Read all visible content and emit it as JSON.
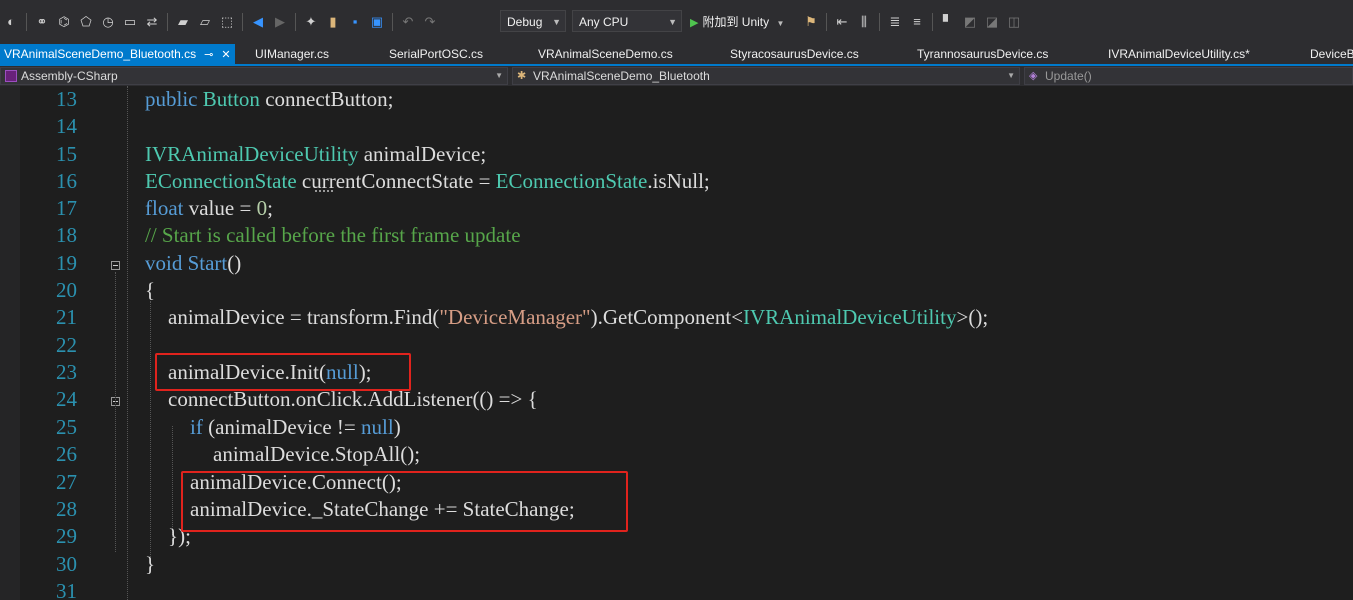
{
  "toolbar": {
    "config_dropdown": "Debug",
    "platform_dropdown": "Any CPU",
    "run_label": "附加到 Unity",
    "icons": [
      "nav-icon",
      "solution-icon",
      "diagram-icon",
      "tag-icon",
      "history-icon",
      "window-icon",
      "sync-icon",
      "folder-icon",
      "open-folder-icon",
      "select-icon",
      "back-icon",
      "forward-icon",
      "new-project-icon",
      "open-icon",
      "save-icon",
      "save-all-icon",
      "undo-icon",
      "redo-icon",
      "find-icon",
      "comment-icon",
      "uncomment-icon",
      "bookmark-icon"
    ]
  },
  "tabs": [
    {
      "label": "VRAnimalSceneDemo_Bluetooth.cs",
      "active": true
    },
    {
      "label": "UIManager.cs"
    },
    {
      "label": "SerialPortOSC.cs"
    },
    {
      "label": "VRAnimalSceneDemo.cs"
    },
    {
      "label": "StyracosaurusDevice.cs"
    },
    {
      "label": "TyrannosaurusDevice.cs"
    },
    {
      "label": "IVRAnimalDeviceUtility.cs*"
    },
    {
      "label": "DeviceBa"
    }
  ],
  "navbar": {
    "project": "Assembly-CSharp",
    "class": "VRAnimalSceneDemo_Bluetooth",
    "member": "Update()"
  },
  "editor": {
    "line_numbers": [
      "13",
      "14",
      "15",
      "16",
      "17",
      "18",
      "19",
      "20",
      "21",
      "22",
      "23",
      "24",
      "25",
      "26",
      "27",
      "28",
      "29",
      "30",
      "31"
    ],
    "lines": {
      "l13": {
        "kw": "public",
        "ty": "Button",
        "rest": "connectButton;"
      },
      "l15": {
        "ty": "IVRAnimalDeviceUtility",
        "rest": "animalDevice;"
      },
      "l16": {
        "ty1": "EConnectionState",
        "v": "currentConnectState",
        "eq": "=",
        "ty2": "EConnectionState",
        "rest": ".isNull;"
      },
      "l17": {
        "kw": "float",
        "rest": "value =",
        "num": "0",
        "end": ";"
      },
      "l18": {
        "comment": "// Start is called before the first frame update"
      },
      "l19": {
        "kw": "void",
        "fn": "Start",
        "rest": "()"
      },
      "l20": {
        "text": "{"
      },
      "l21": {
        "a": "animalDevice = transform.Find(",
        "str": "\"DeviceManager\"",
        "b": ").GetComponent<",
        "ty": "IVRAnimalDeviceUtility",
        "c": ">();"
      },
      "l23": {
        "a": "animalDevice.Init(",
        "kw": "null",
        "b": ");"
      },
      "l24": {
        "text": "connectButton.onClick.AddListener(() => {"
      },
      "l25": {
        "kw1": "if",
        "a": "(animalDevice !=",
        "kw2": "null",
        "b": ")"
      },
      "l26": {
        "text": "animalDevice.StopAll();"
      },
      "l27": {
        "text": "animalDevice.Connect();"
      },
      "l28": {
        "text": "animalDevice._StateChange += StateChange;"
      },
      "l29": {
        "text": "});"
      },
      "l30": {
        "text": "}"
      }
    }
  },
  "colors": {
    "keyword": "#569cd6",
    "type": "#4ec9b0",
    "string": "#d69d85",
    "comment": "#57a64a",
    "number": "#b5cea8",
    "line_number": "#2b91af",
    "highlight_box": "#e0231d",
    "accent": "#007acc"
  }
}
